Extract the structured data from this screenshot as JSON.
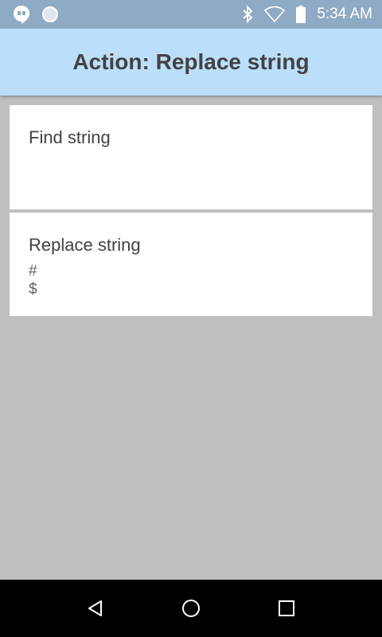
{
  "status_bar": {
    "time": "5:34 AM",
    "icons": [
      "hangouts-icon",
      "sync-icon",
      "bluetooth-icon",
      "wifi-icon",
      "battery-icon"
    ]
  },
  "app_bar": {
    "title": "Action: Replace string"
  },
  "settings": [
    {
      "title": "Find string",
      "value": ""
    },
    {
      "title": "Replace string",
      "value": "#\n$"
    }
  ],
  "nav_bar": {
    "icons": [
      "back-icon",
      "home-icon",
      "recents-icon"
    ]
  },
  "colors": {
    "status_bar": "#8faac4",
    "app_bar": "#bbdefb",
    "background": "#bfbfbf",
    "card": "#ffffff",
    "nav_bar": "#000000"
  }
}
